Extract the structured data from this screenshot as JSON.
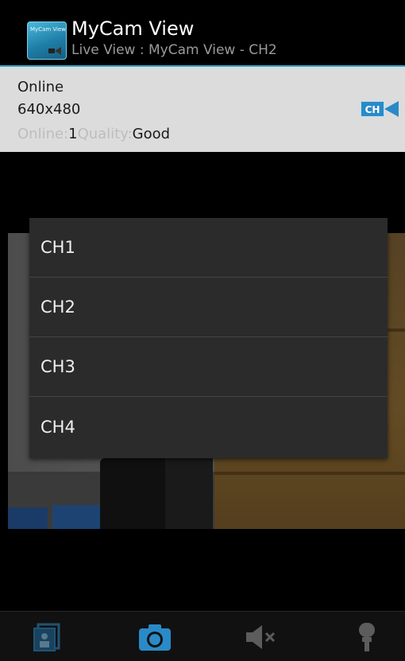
{
  "header": {
    "app_icon_text": "MyCam View",
    "title": "MyCam View",
    "subtitle": "Live View : MyCam View - CH2"
  },
  "info": {
    "status": "Online",
    "resolution": "640x480",
    "online_label": "Online:",
    "online_count": "1",
    "quality_label": "Quality:",
    "quality_value": "Good",
    "channel_button": "CH"
  },
  "dialog": {
    "items": [
      {
        "label": "CH1"
      },
      {
        "label": "CH2"
      },
      {
        "label": "CH3"
      },
      {
        "label": "CH4"
      }
    ]
  },
  "toolbar": {
    "buttons": [
      {
        "icon": "gallery-icon"
      },
      {
        "icon": "camera-icon"
      },
      {
        "icon": "speaker-muted-icon"
      },
      {
        "icon": "microphone-icon"
      }
    ]
  },
  "colors": {
    "accent": "#2aa6c9",
    "panel": "#dcdcdc",
    "dialog": "#2b2b2b",
    "icon_blue": "#2a8ac8"
  }
}
